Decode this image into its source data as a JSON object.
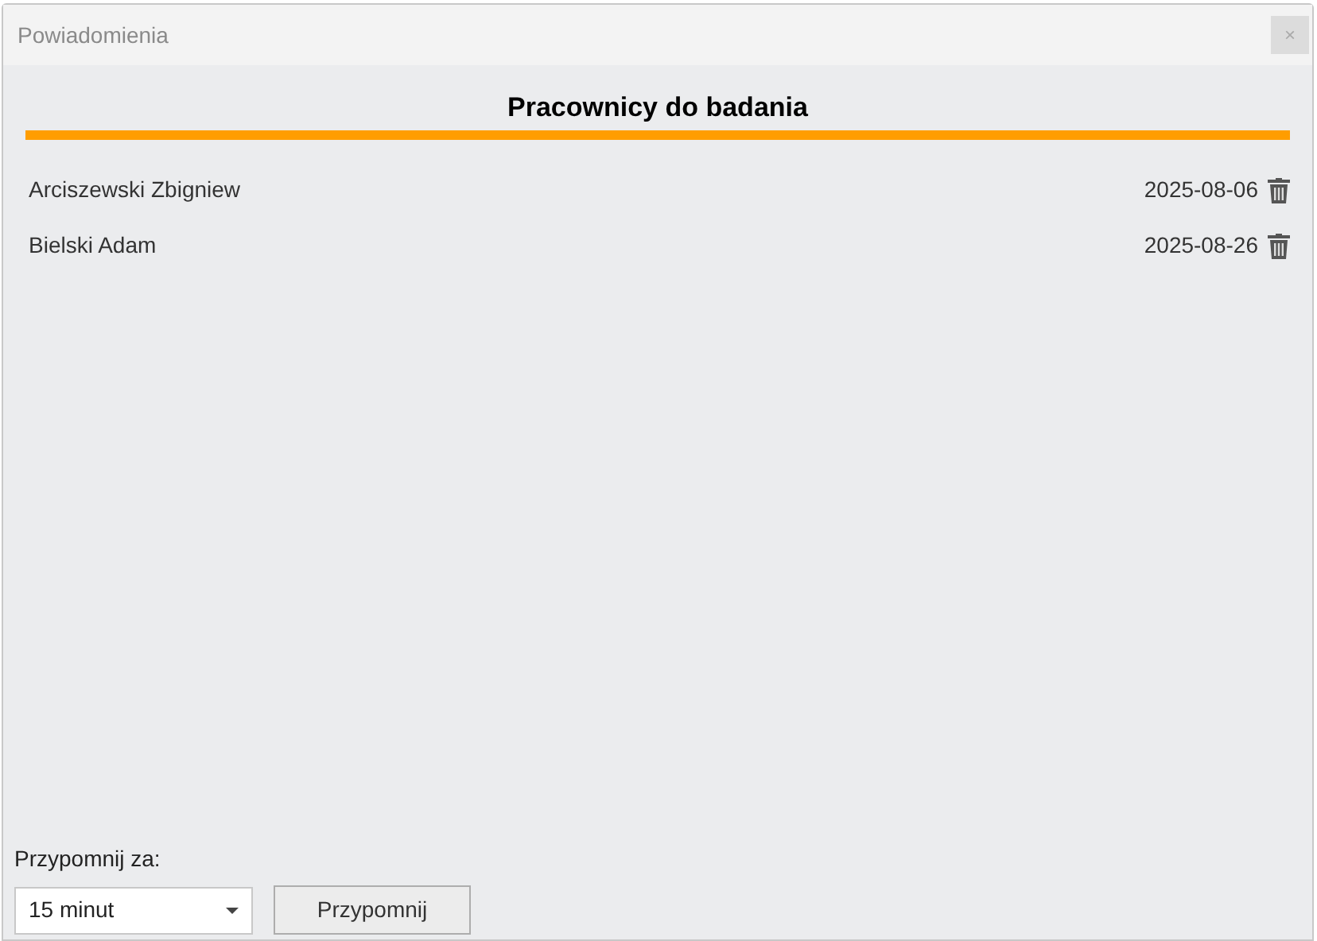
{
  "window": {
    "title": "Powiadomienia",
    "close": "×"
  },
  "heading": "Pracownicy do badania",
  "employees": [
    {
      "name": "Arciszewski Zbigniew",
      "date": "2025-08-06"
    },
    {
      "name": "Bielski Adam",
      "date": "2025-08-26"
    }
  ],
  "remind": {
    "label": "Przypomnij za:",
    "value": "15 minut",
    "button": "Przypomnij"
  }
}
